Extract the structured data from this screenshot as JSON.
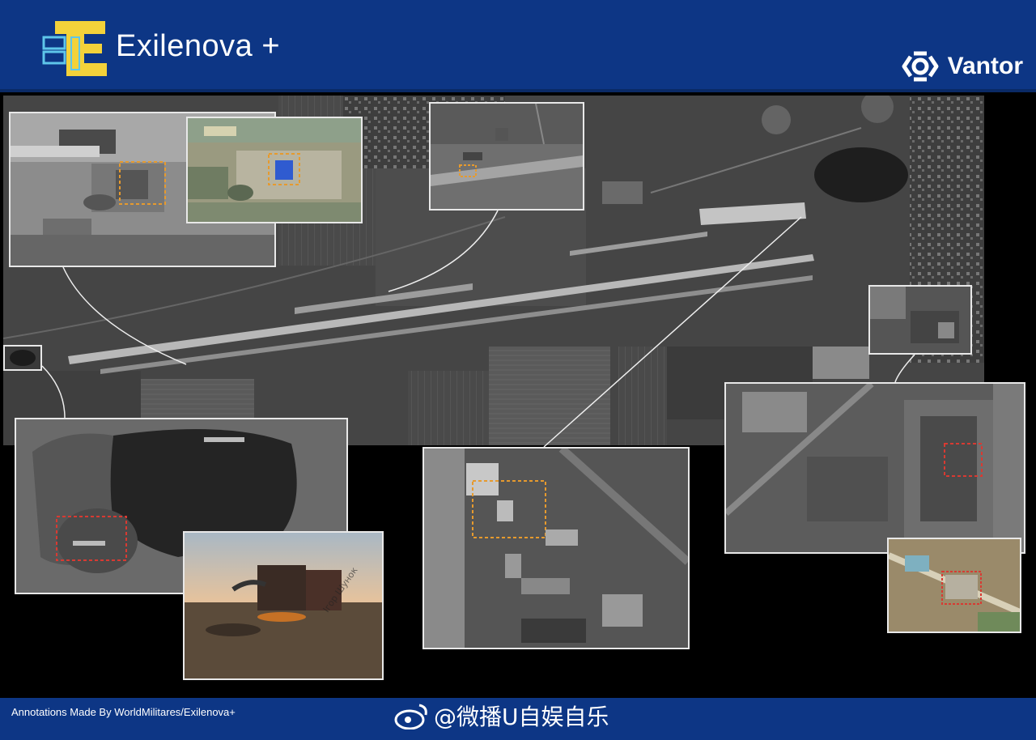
{
  "header": {
    "brand_name": "Exilenova +",
    "partner_name": "Vantor"
  },
  "footer": {
    "credit": "Annotations Made By WorldMilitares/Exilenova+",
    "watermark": "@微播U自娱自乐"
  },
  "photo": {
    "signature": "Ігор Шунок"
  },
  "colors": {
    "header_bg": "#0d3685",
    "callout_orange": "#e69a2e",
    "callout_red": "#d83a32",
    "inset_border": "#e8e8e8",
    "logo_yellow": "#f3d23a",
    "logo_cyan": "#5ec6ea"
  }
}
